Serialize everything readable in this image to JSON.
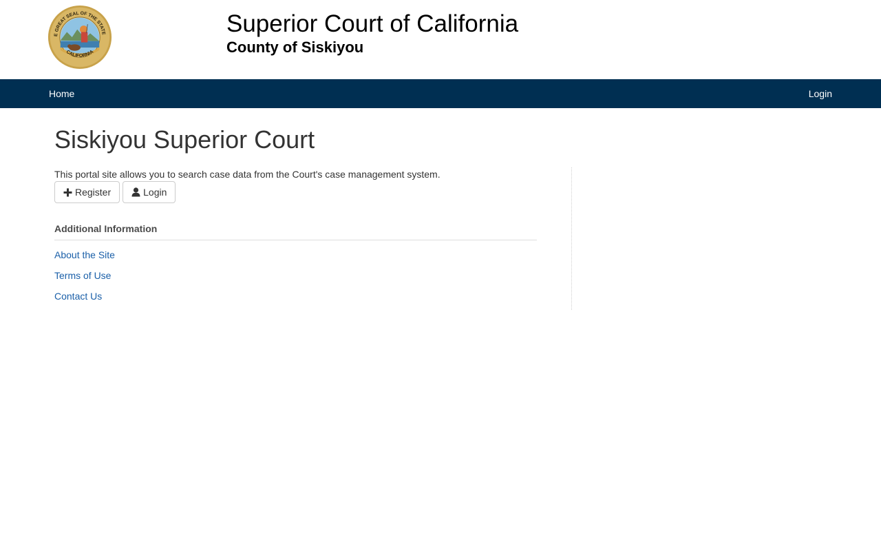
{
  "header": {
    "seal_text_top": "THE GREAT SEAL OF THE STATE OF",
    "seal_text_bottom": "CALIFORNIA",
    "title": "Superior Court of California",
    "subtitle": "County of Siskiyou"
  },
  "nav": {
    "home_label": "Home",
    "login_label": "Login",
    "background": "#002f52"
  },
  "main": {
    "page_title": "Siskiyou Superior Court",
    "intro_text": "This portal site allows you to search case data from the Court's case management system.",
    "buttons": {
      "register_icon": "plus-icon",
      "register_label": "Register",
      "login_icon": "user-icon",
      "login_label": "Login"
    },
    "additional_info": {
      "heading": "Additional Information",
      "links": [
        "About the Site",
        "Terms of Use",
        "Contact Us"
      ]
    }
  },
  "colors": {
    "link": "#1a5fa8",
    "nav_text": "#ffffff"
  }
}
